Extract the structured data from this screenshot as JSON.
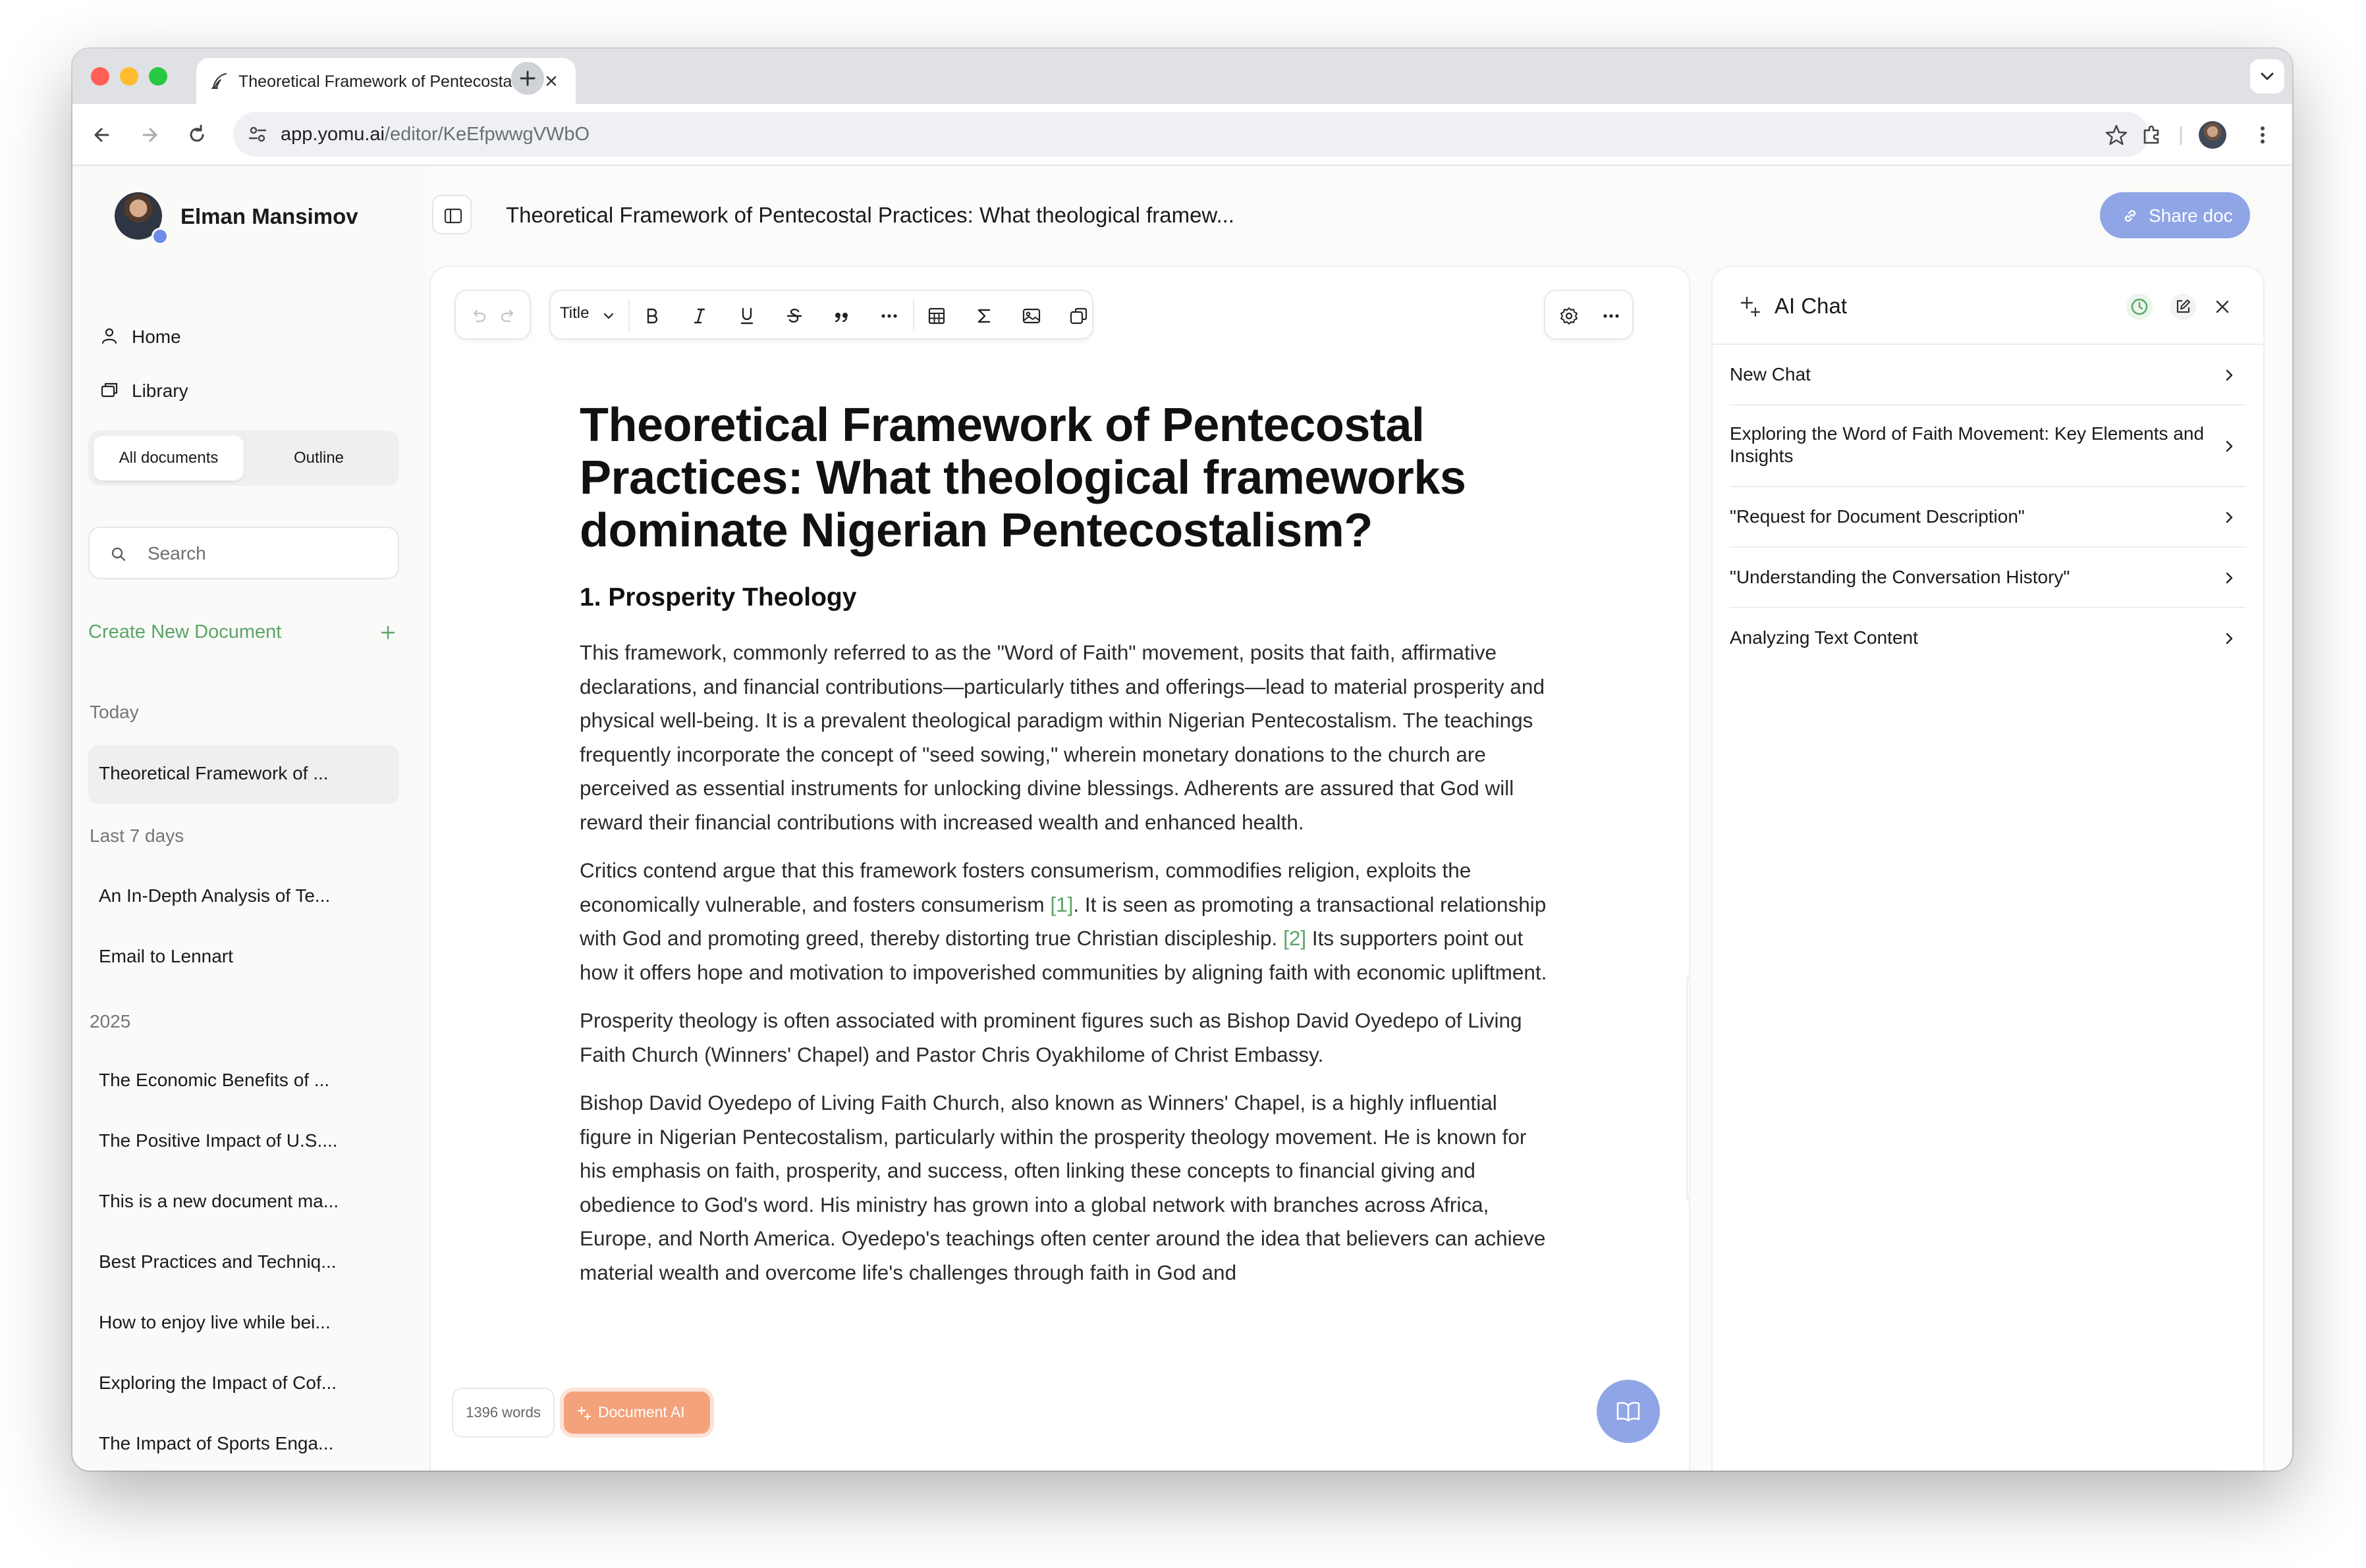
{
  "browser": {
    "tab_title": "Theoretical Framework of Pentecostal Practices",
    "url_host": "app.yomu.ai",
    "url_path": "/editor/KeEfpwwgVWbO"
  },
  "sidebar": {
    "user_name": "Elman Mansimov",
    "nav": [
      {
        "label": "Home",
        "icon": "home-icon"
      },
      {
        "label": "Library",
        "icon": "library-icon"
      }
    ],
    "tabs": [
      "All documents",
      "Outline"
    ],
    "active_tab": "All documents",
    "search_placeholder": "Search",
    "create_label": "Create New Document",
    "sections": [
      {
        "label": "Today",
        "items": [
          "Theoretical Framework of ..."
        ]
      },
      {
        "label": "Last 7 days",
        "items": [
          "An In-Depth Analysis of Te...",
          "Email to Lennart"
        ]
      },
      {
        "label": "2025",
        "items": [
          "The Economic Benefits of ...",
          "The Positive Impact of U.S....",
          "This is a new document ma...",
          "Best Practices and Techniq...",
          "How to enjoy live while bei...",
          "Exploring the Impact of Cof...",
          "The Impact of Sports Enga..."
        ]
      }
    ]
  },
  "header": {
    "doc_title": "Theoretical Framework of Pentecostal Practices: What theological framew...",
    "share_label": "Share doc"
  },
  "editor": {
    "toolbar": {
      "block_type": "Title",
      "icons": [
        "undo-icon",
        "redo-icon",
        "bold-icon",
        "italic-icon",
        "underline-icon",
        "strikethrough-icon",
        "quote-icon",
        "more-icon",
        "table-icon",
        "sigma-icon",
        "image-icon",
        "copy-icon",
        "settings-icon",
        "more-options-icon"
      ]
    },
    "heading": "Theoretical Framework of Pentecostal Practices: What theological frameworks dominate Nigerian Pentecostalism?",
    "subheading": "1. Prosperity Theology",
    "p1": "This framework, commonly referred to as the \"Word of Faith\" movement, posits that faith, affirmative declarations, and financial contributions—particularly tithes and offerings—lead to material prosperity and physical well-being. It is a prevalent theological paradigm within Nigerian Pentecostalism. The teachings frequently incorporate the concept of \"seed sowing,\" wherein monetary donations to the church are perceived as essential instruments for unlocking divine blessings. Adherents are assured that God will reward their financial contributions with increased wealth and enhanced health.",
    "p2_a": "Critics contend argue that this framework fosters consumerism, commodifies religion, exploits the economically vulnerable, and fosters consumerism ",
    "p2_cite1": "[1]",
    "p2_b": ". It is seen as promoting a transactional relationship with God and promoting greed, thereby distorting true Christian discipleship. ",
    "p2_cite2": "[2]",
    "p2_c": " Its supporters point out how it offers hope and motivation to impoverished communities by aligning faith with economic upliftment.",
    "p3": "Prosperity theology is often associated with prominent figures such as Bishop David Oyedepo of Living Faith Church (Winners' Chapel) and Pastor Chris Oyakhilome of Christ Embassy.",
    "p4": "Bishop David Oyedepo of Living Faith Church, also known as Winners' Chapel, is a highly influential figure in Nigerian Pentecostalism, particularly within the prosperity theology movement. He is known for his emphasis on faith, prosperity, and success, often linking these concepts to financial giving and obedience to God's word. His ministry has grown into a global network with branches across Africa, Europe, and North America. Oyedepo's teachings often center around the idea that believers can achieve material wealth and overcome life's challenges through faith in God and",
    "word_count": "1396 words",
    "document_ai_label": "Document AI",
    "side_tools": [
      "us-flag-icon",
      "document-check-icon",
      "copy-pages-icon",
      "chat-search-icon",
      "scan-search-icon"
    ]
  },
  "chat": {
    "title": "AI Chat",
    "items": [
      "New Chat",
      "Exploring the Word of Faith Movement: Key Elements and Insights",
      "\"Request for Document Description\"",
      "\"Understanding the Conversation History\"",
      "Analyzing Text Content"
    ]
  },
  "colors": {
    "accent_green": "#5aa565",
    "share_blue": "#8fa5e6",
    "document_ai_orange": "#f4a27b"
  }
}
